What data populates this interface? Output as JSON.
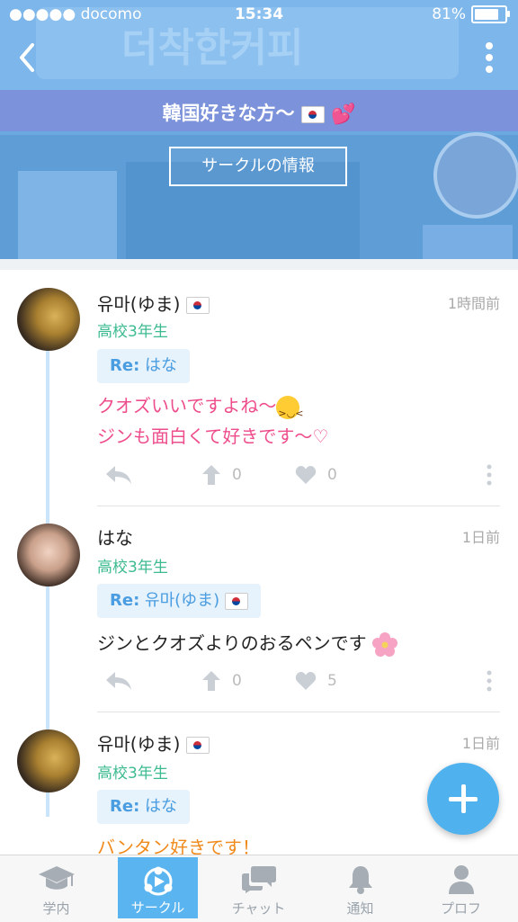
{
  "status_bar": {
    "carrier": "●●●●● docomo",
    "time": "15:34",
    "battery": "81%"
  },
  "header": {
    "circle_title": "韓国好きな方〜",
    "info_button": "サークルの情報",
    "background_sign_text": "더착한커피"
  },
  "posts": [
    {
      "username": "유마(ゆま)",
      "grade": "高校3年生",
      "time": "1時間前",
      "reply_to": "Re: はな",
      "reply_prefix": "Re:",
      "reply_name": "はな",
      "lines": [
        "クオズいいですよね〜",
        "ジンも面白くて好きです〜♡"
      ],
      "likes_up": "0",
      "likes_heart": "0"
    },
    {
      "username": "はな",
      "grade": "高校3年生",
      "time": "1日前",
      "reply_prefix": "Re:",
      "reply_name": "유마(ゆま)",
      "lines": [
        "ジンとクオズよりのおるペンです"
      ],
      "likes_up": "0",
      "likes_heart": "5"
    },
    {
      "username": "유마(ゆま)",
      "grade": "高校3年生",
      "time": "1日前",
      "reply_prefix": "Re:",
      "reply_name": "はな",
      "lines": [
        "バンタン好きです！"
      ]
    }
  ],
  "bottom_nav": [
    {
      "label": "学内",
      "icon": "graduation-cap-icon",
      "active": false
    },
    {
      "label": "サークル",
      "icon": "circle-network-icon",
      "active": true
    },
    {
      "label": "チャット",
      "icon": "chat-bubbles-icon",
      "active": false
    },
    {
      "label": "通知",
      "icon": "bell-icon",
      "active": false
    },
    {
      "label": "プロフ",
      "icon": "profile-icon",
      "active": false
    }
  ],
  "colors": {
    "accent": "#5ab4ef",
    "grade_green": "#3dbb8f",
    "pink_text": "#ee4d8c",
    "orange_text": "#f08a1c"
  }
}
